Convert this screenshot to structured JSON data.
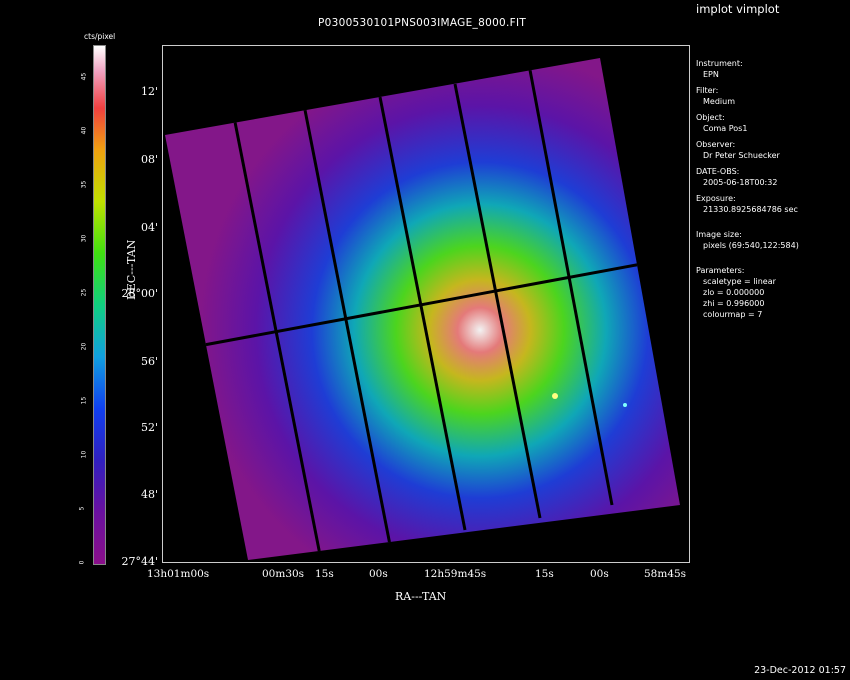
{
  "app_title": "implot vimplot",
  "plot_title": "P0300530101PNS003IMAGE_8000.FIT",
  "footer_date": "23-Dec-2012 01:57",
  "colorbar": {
    "label": "cts/pixel",
    "ticks": [
      "0",
      "5",
      "10",
      "15",
      "20",
      "25",
      "30",
      "35",
      "40",
      "45"
    ]
  },
  "axes": {
    "xlabel": "RA---TAN",
    "ylabel": "DEC---TAN",
    "y_ticks": [
      "12'",
      "08'",
      "04'",
      "28°00'",
      "56'",
      "52'",
      "48'",
      "27°44'"
    ],
    "x_ticks": [
      "13h01m00s",
      "00m30s",
      "15s",
      "00s",
      "12h59m45s",
      "15s",
      "00s",
      "58m45s"
    ]
  },
  "info": {
    "instrument_label": "Instrument:",
    "instrument": "EPN",
    "filter_label": "Filter:",
    "filter": "Medium",
    "object_label": "Object:",
    "object": "Coma Pos1",
    "observer_label": "Observer:",
    "observer": "Dr Peter Schuecker",
    "date_label": "DATE-OBS:",
    "date": "2005-06-18T00:32",
    "exposure_label": "Exposure:",
    "exposure": "21330.8925684786 sec",
    "size_label": "Image size:",
    "size": "pixels (69:540,122:584)",
    "params_label": "Parameters:",
    "scaletype": "scaletype = linear",
    "zlo": "zlo = 0.000000",
    "zhi": "zhi = 0.996000",
    "colourmap": "colourmap =    7"
  }
}
